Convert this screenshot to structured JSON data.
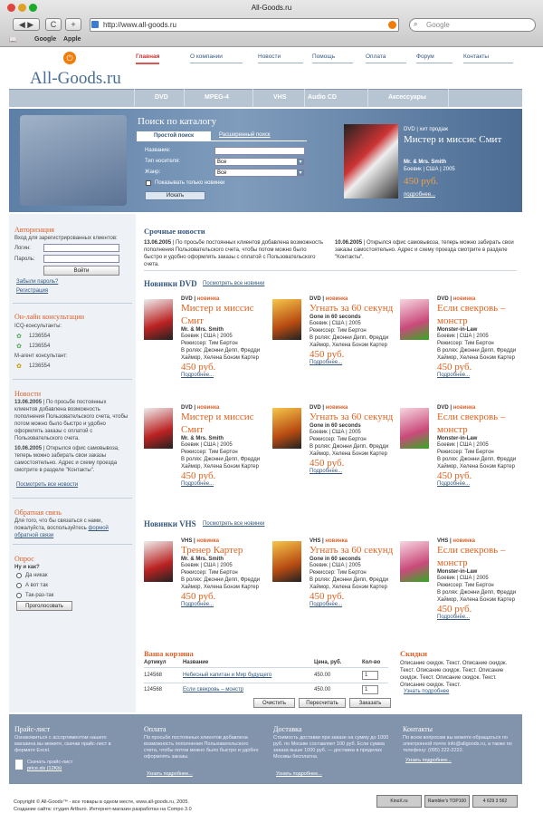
{
  "browser": {
    "window_title": "All-Goods.ru",
    "url": "http://www.all-goods.ru",
    "search_placeholder": "Google",
    "bookmarks": [
      "Google",
      "Apple"
    ]
  },
  "site": {
    "logo": "All-Goods.ru",
    "top_nav": [
      "Главная",
      "О компании",
      "Новости",
      "Помощь",
      "Оплата",
      "Форум",
      "Контакты"
    ],
    "categories": [
      "DVD",
      "MPEG-4",
      "VHS",
      "Audio CD",
      "Аксессуары"
    ]
  },
  "search": {
    "title": "Поиск по каталогу",
    "tab_simple": "Простой поиск",
    "tab_advanced": "Расширенный поиск",
    "name_label": "Название:",
    "carrier_label": "Тип носителя:",
    "carrier_value": "Все",
    "genre_label": "Жанр:",
    "genre_value": "Все",
    "only_new_label": "Показывать только новинки",
    "button": "Искать"
  },
  "featured": {
    "category": "DVD | хит продаж",
    "title": "Мистер и миссис Смит",
    "original": "Mr. & Mrs. Smith",
    "meta": "Боевик | США | 2005",
    "price": "450 руб.",
    "more": "подробнее..."
  },
  "sidebar": {
    "auth_title": "Авторизация",
    "auth_text": "Вход для зарегистрированных клиентов:",
    "login_label": "Логин:",
    "password_label": "Пароль:",
    "login_button": "Войти",
    "forgot": "Забыли пароль?",
    "register": "Регистрация",
    "consult_title": "Он-лайн консультации",
    "icq_label": "ICQ-консультанты:",
    "icq1": "1236554",
    "icq2": "1236554",
    "magent_label": "M-агент консультант:",
    "magent1": "1236554",
    "news_title": "Новости",
    "news1_date": "13.06.2005",
    "news1_text": "По просьбе постоянных клиентов добавлена возможность пополнения Пользовательского счета, чтобы потом можно было быстро и удобно оформлять заказы с оплатой с Пользовательского счета.",
    "news2_date": "10.06.2005",
    "news2_text": "Открылся офис самовывоза, теперь можно забирать свои заказы самостоятельно. Адрес и схему проезда смотрите в разделе \"Контакты\".",
    "news_all": "Посмотреть все новости",
    "feedback_title": "Обратная связь",
    "feedback_text": "Для того, что бы связаться с нами, пожалуйста, воспользуйтесь",
    "feedback_link": "формой обратной связи",
    "poll_title": "Опрос",
    "poll_question": "Ну и как?",
    "poll_options": [
      "Да никак",
      "А вот так",
      "Так-раз-так"
    ],
    "poll_button": "Проголосовать"
  },
  "urgent": {
    "title": "Срочные новости",
    "n1_date": "13.06.2005",
    "n1_text": "По просьбе постоянных клиентов добавлена возможность пополнения Пользовательского счета, чтобы потом можно было быстро и удобно оформлять заказы с оплатой с Пользовательского счета.",
    "n2_date": "10.06.2005",
    "n2_text": "Открылся офис самовывоза, теперь можно забирать свои заказы самостоятельно. Адрес и схему проезда смотрите в разделе \"Контакты\"."
  },
  "dvd_section": {
    "title": "Новинки DVD",
    "link": "Посмотреть все новинки"
  },
  "vhs_section": {
    "title": "Новинки VHS",
    "link": "Посмотреть все новинки"
  },
  "products": [
    {
      "cat": "DVD",
      "badge": "новинка",
      "title": "Мистер и миссис Смит",
      "orig": "Mr. & Mrs. Smith",
      "meta": "Боевик | США | 2005",
      "director": "Режиссер: Тим Бертон",
      "cast": "В ролях: Джонни Депп, Фредди Хаймор, Хелена Бонэм Картер",
      "price": "450 руб.",
      "more": "Подробнее..."
    },
    {
      "cat": "DVD",
      "badge": "новинка",
      "title": "Угнать за 60 секунд",
      "orig": "Gone in 60 seconds",
      "meta": "Боевик | США | 2005",
      "director": "Режиссер: Тим Бертон",
      "cast": "В ролях: Джонни Депп, Фредди Хаймор, Хелена Бонэм Картер",
      "price": "450 руб.",
      "more": "Подробнее..."
    },
    {
      "cat": "DVD",
      "badge": "новинка",
      "title": "Если свекровь – монстр",
      "orig": "Monster-in-Law",
      "meta": "Боевик | США | 2005",
      "director": "Режиссер: Тим Бертон",
      "cast": "В ролях: Джонни Депп, Фредди Хаймор, Хелена Бонэм Картер",
      "price": "450 руб.",
      "more": "Подробнее..."
    },
    {
      "cat": "DVD",
      "badge": "новинка",
      "title": "Мистер и миссис Смит",
      "orig": "Mr. & Mrs. Smith",
      "meta": "Боевик | США | 2005",
      "director": "Режиссер: Тим Бертон",
      "cast": "В ролях: Джонни Депп, Фредди Хаймор, Хелена Бонэм Картер",
      "price": "450 руб.",
      "more": "Подробнее..."
    },
    {
      "cat": "DVD",
      "badge": "новинка",
      "title": "Угнать за 60 секунд",
      "orig": "Gone in 60 seconds",
      "meta": "Боевик | США | 2005",
      "director": "Режиссер: Тим Бертон",
      "cast": "В ролях: Джонни Депп, Фредди Хаймор, Хелена Бонэм Картер",
      "price": "450 руб.",
      "more": "Подробнее..."
    },
    {
      "cat": "DVD",
      "badge": "новинка",
      "title": "Если свекровь – монстр",
      "orig": "Monster-in-Law",
      "meta": "Боевик | США | 2005",
      "director": "Режиссер: Тим Бертон",
      "cast": "В ролях: Джонни Депп, Фредди Хаймор, Хелена Бонэм Картер",
      "price": "450 руб.",
      "more": "Подробнее..."
    },
    {
      "cat": "VHS",
      "badge": "новинка",
      "title": "Тренер Картер",
      "orig": "Mr. & Mrs. Smith",
      "meta": "Боевик | США | 2005",
      "director": "Режиссер: Тим Бертон",
      "cast": "В ролях: Джонни Депп, Фредди Хаймор, Хелена Бонэм Картер",
      "price": "450 руб.",
      "more": "Подробнее..."
    },
    {
      "cat": "VHS",
      "badge": "новинка",
      "title": "Угнать за 60 секунд",
      "orig": "Gone in 60 seconds",
      "meta": "Боевик | США | 2005",
      "director": "Режиссер: Тим Бертон",
      "cast": "В ролях: Джонни Депп, Фредди Хаймор, Хелена Бонэм Картер",
      "price": "450 руб.",
      "more": "Подробнее..."
    },
    {
      "cat": "VHS",
      "badge": "новинка",
      "title": "Если свекровь – монстр",
      "orig": "Monster-in-Law",
      "meta": "Боевик | США | 2005",
      "director": "Режиссер: Тим Бертон",
      "cast": "В ролях: Джонни Депп, Фредди Хаймор, Хелена Бонэм Картер",
      "price": "450 руб.",
      "more": "Подробнее..."
    }
  ],
  "cart": {
    "title": "Ваша корзина",
    "headers": [
      "Артикул",
      "Название",
      "Цена, руб.",
      "Кол-во"
    ],
    "rows": [
      {
        "sku": "124568",
        "name": "Небесный капитан и Мир будущего",
        "price": "450.00",
        "qty": "1"
      },
      {
        "sku": "124568",
        "name": "Если свекровь – монстр",
        "price": "450.00",
        "qty": "1"
      }
    ],
    "clear": "Очистить",
    "recalc": "Пересчитать",
    "order": "Заказать"
  },
  "discounts": {
    "title": "Скидки",
    "text": "Описание скидок. Текст. Описание скидок. Текст. Описание скидок. Текст. Описание скидок. Текст. Описание скидок. Текст. Описание скидок. Текст.",
    "link": "Узнать подробнее"
  },
  "footer": {
    "price_title": "Прайс-лист",
    "price_text": "Ознакомиться с ассортиментом нашего магазина вы можете, скачав прайс-лист в формате Excel.",
    "price_download": "Скачать прайс-лист",
    "price_file": "price.xls (12Kb)",
    "pay_title": "Оплата",
    "pay_text": "По просьбе постоянных клиентов добавлена возможность пополнения Пользовательского счета, чтобы потом можно было быстро и удобно оформлять заказы.",
    "pay_link": "Узнать подробнее...",
    "del_title": "Доставка",
    "del_text": "Стоимость доставки при заказе на сумму до 1000 руб. по Москве составляет 100 руб. Если сумма заказа выше 1000 руб. — доставка в пределах Москвы бесплатна.",
    "del_link": "Узнать подробнее...",
    "cont_title": "Контакты",
    "cont_text": "По всем вопросам вы можете обращаться по электронной почте info@allgoods.ru, а также по телефону: (095) 222-2222.",
    "cont_link": "Узнать подробнее...",
    "copyright": "Copyright © All-Goods™ - все товары в одном месте, www.all-goods.ru, 2005.",
    "credits": "Создание сайта: студия Artburo. Интернет-магазин разработан на Compo 3.0",
    "badges": [
      "KinoX.ru",
      "Rambler's TOP100",
      "4 629 3 562"
    ]
  }
}
